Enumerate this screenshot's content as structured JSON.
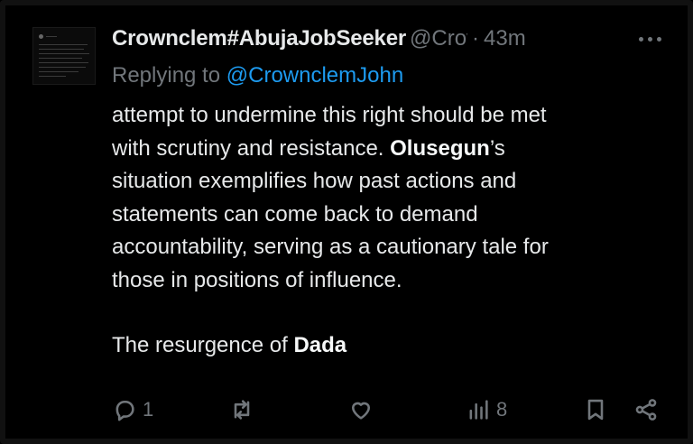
{
  "post": {
    "display_name": "Crownclem#AbujaJobSeeker",
    "handle": "@Crov",
    "separator": "·",
    "time": "43m",
    "replying_prefix": "Replying to",
    "replying_handle": "@CrownclemJohn",
    "body": {
      "l1": "attempt to undermine this right should be met",
      "l2_pre": "with scrutiny and resistance.",
      "l2_bold": "Olusegun",
      "l2_post": "’s",
      "l3": "situation exemplifies how past actions and",
      "l4": "statements can come back to demand",
      "l5": "accountability, serving as a cautionary tale for",
      "l6": "those in positions of influence.",
      "l7_pre": "The resurgence of",
      "l7_bold": "Dada"
    }
  },
  "actions": {
    "reply": {
      "icon": "reply-icon",
      "count": "1"
    },
    "repost": {
      "icon": "repost-icon",
      "count": ""
    },
    "like": {
      "icon": "heart-icon",
      "count": ""
    },
    "views": {
      "icon": "views-icon",
      "count": "8"
    },
    "bookmark": {
      "icon": "bookmark-icon"
    },
    "share": {
      "icon": "share-icon"
    }
  },
  "colors": {
    "background": "#000000",
    "text": "#e7e9ea",
    "muted": "#71767b",
    "link": "#1d9bf0"
  }
}
